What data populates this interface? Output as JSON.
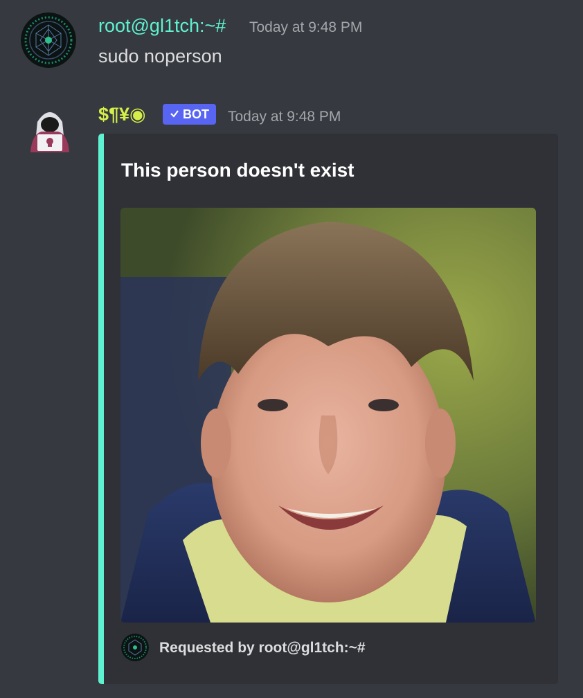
{
  "message1": {
    "username": "root@gl1tch:~#",
    "timestamp": "Today at 9:48 PM",
    "content": "sudo noperson",
    "username_color": "#5ff2d0"
  },
  "message2": {
    "username": "$¶¥◉",
    "bot_tag": "BOT",
    "timestamp": "Today at 9:48 PM",
    "username_color": "#d4ef4a",
    "embed": {
      "title": "This person doesn't exist",
      "footer_text": "Requested by root@gl1tch:~#",
      "accent_color": "#5ff2d0",
      "image": "generated-face-photo"
    }
  }
}
